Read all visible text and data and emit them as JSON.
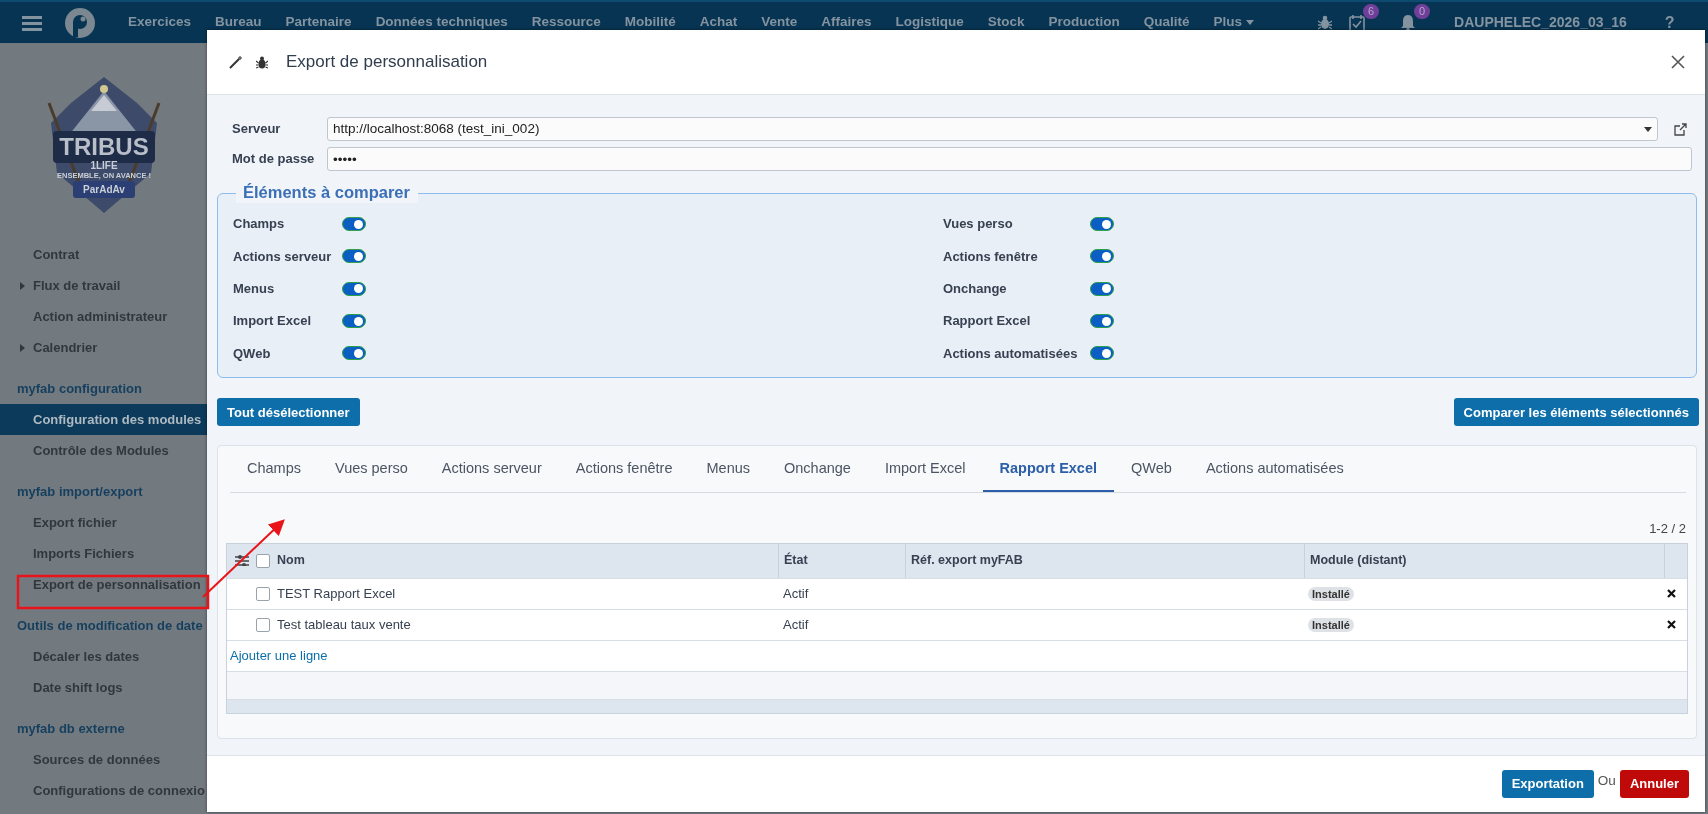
{
  "navbar": {
    "items": [
      "Exercices",
      "Bureau",
      "Partenaire",
      "Données techniques",
      "Ressource",
      "Mobilité",
      "Achat",
      "Vente",
      "Affaires",
      "Logistique",
      "Stock",
      "Production",
      "Qualité"
    ],
    "more": "Plus",
    "task_count": "6",
    "notification_count": "0",
    "database": "DAUPHELEC_2026_03_16",
    "help": "?"
  },
  "logo": {
    "title": "TRIBUS",
    "subtitle": "1LIFE",
    "motto": "ENSEMBLE, ON AVANCE !",
    "banner": "ParAdAv"
  },
  "sidebar": {
    "items": [
      {
        "kind": "link",
        "label": "Contrat",
        "selected": false
      },
      {
        "kind": "folder",
        "label": "Flux de travail",
        "selected": false
      },
      {
        "kind": "link",
        "label": "Action administrateur",
        "selected": false
      },
      {
        "kind": "folder",
        "label": "Calendrier",
        "selected": false
      },
      {
        "kind": "heading",
        "label": "myfab configuration"
      },
      {
        "kind": "link",
        "label": "Configuration des modules",
        "selected": true
      },
      {
        "kind": "link",
        "label": "Contrôle des Modules",
        "selected": false
      },
      {
        "kind": "heading",
        "label": "myfab import/export"
      },
      {
        "kind": "link",
        "label": "Export fichier",
        "selected": false
      },
      {
        "kind": "link",
        "label": "Imports Fichiers",
        "selected": false
      },
      {
        "kind": "link",
        "label": "Export de personnalisation",
        "selected": false
      },
      {
        "kind": "heading",
        "label": "Outils de modification de date"
      },
      {
        "kind": "link",
        "label": "Décaler les dates",
        "selected": false
      },
      {
        "kind": "link",
        "label": "Date shift logs",
        "selected": false
      },
      {
        "kind": "heading",
        "label": "myfab db externe"
      },
      {
        "kind": "link",
        "label": "Sources de données",
        "selected": false
      },
      {
        "kind": "link",
        "label": "Configurations de connexio",
        "selected": false
      }
    ]
  },
  "dialog": {
    "title": "Export de personnalisation",
    "server": {
      "label": "Serveur",
      "value": "http://localhost:8068 (test_ini_002)"
    },
    "password": {
      "label": "Mot de passe",
      "value": "•••••"
    },
    "elements": {
      "legend": "Éléments à comparer",
      "left": [
        {
          "label": "Champs",
          "on": true
        },
        {
          "label": "Actions serveur",
          "on": true
        },
        {
          "label": "Menus",
          "on": true
        },
        {
          "label": "Import Excel",
          "on": true
        },
        {
          "label": "QWeb",
          "on": true
        }
      ],
      "right": [
        {
          "label": "Vues perso",
          "on": true
        },
        {
          "label": "Actions fenêtre",
          "on": true
        },
        {
          "label": "Onchange",
          "on": true
        },
        {
          "label": "Rapport Excel",
          "on": true
        },
        {
          "label": "Actions automatisées",
          "on": true
        }
      ]
    },
    "deselect_button": "Tout désélectionner",
    "compare_button": "Comparer les éléments sélectionnés",
    "tabs": [
      {
        "label": "Champs",
        "selected": false
      },
      {
        "label": "Vues perso",
        "selected": false
      },
      {
        "label": "Actions serveur",
        "selected": false
      },
      {
        "label": "Actions fenêtre",
        "selected": false
      },
      {
        "label": "Menus",
        "selected": false
      },
      {
        "label": "Onchange",
        "selected": false
      },
      {
        "label": "Import Excel",
        "selected": false
      },
      {
        "label": "Rapport Excel",
        "selected": true
      },
      {
        "label": "QWeb",
        "selected": false
      },
      {
        "label": "Actions automatisées",
        "selected": false
      }
    ],
    "pager": "1-2 / 2",
    "table": {
      "columns": [
        "Nom",
        "État",
        "Réf. export myFAB",
        "Module (distant)"
      ],
      "header_checked": false,
      "rows": [
        {
          "name": "TEST Rapport Excel",
          "state": "Actif",
          "module": "Installé",
          "checked": false
        },
        {
          "name": "Test tableau taux vente",
          "state": "Actif",
          "module": "Installé",
          "checked": false
        }
      ],
      "add_line": "Ajouter une ligne"
    },
    "footer": {
      "export": "Exportation",
      "or": "Ou",
      "cancel": "Annuler"
    }
  }
}
